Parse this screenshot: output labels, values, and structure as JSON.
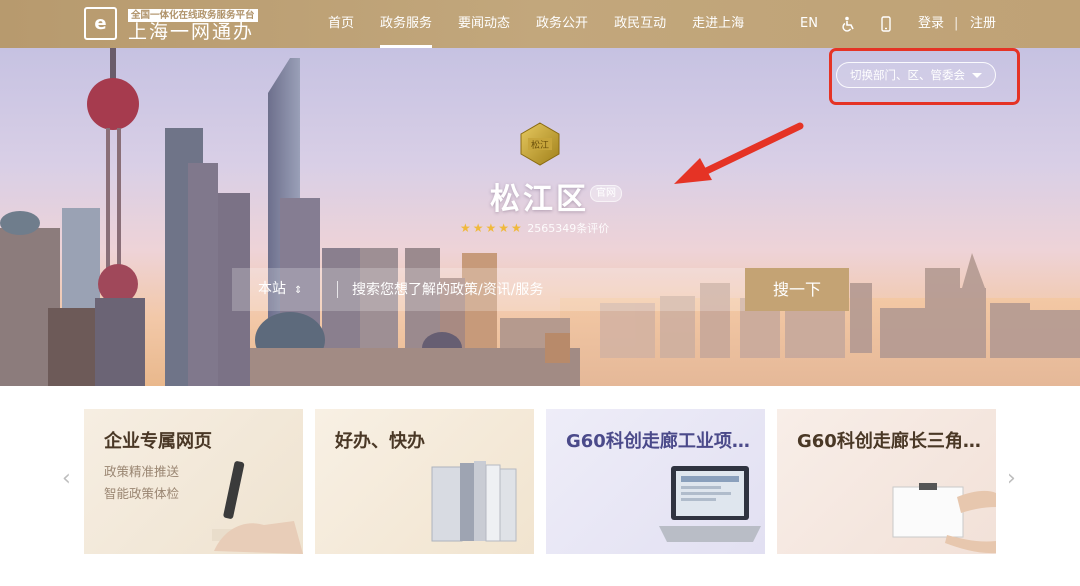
{
  "header": {
    "logo_badge": "全国一体化在线政务服务平台",
    "logo_title": "上海一网通办",
    "nav": [
      {
        "label": "首页"
      },
      {
        "label": "政务服务"
      },
      {
        "label": "要闻动态"
      },
      {
        "label": "政务公开"
      },
      {
        "label": "政民互动"
      },
      {
        "label": "走进上海"
      }
    ],
    "lang": "EN",
    "login": "登录",
    "separator": "|",
    "register": "注册"
  },
  "hero": {
    "switch_label": "切换部门、区、管委会",
    "district_name": "松江区",
    "official_badge": "官网",
    "emblem_text": "松江",
    "stars": "★★★★★",
    "review_count": "2565349条评价",
    "search": {
      "scope": "本站",
      "scope_icon": "⇕",
      "placeholder": "搜索您想了解的政策/资讯/服务",
      "button": "搜一下"
    }
  },
  "cards": [
    {
      "title": "企业专属网页",
      "subs": [
        "政策精准推送",
        "智能政策体检"
      ]
    },
    {
      "title": "好办、快办",
      "subs": []
    },
    {
      "title": "G60科创走廊工业项…",
      "subs": []
    },
    {
      "title": "G60科创走廊长三角…",
      "subs": []
    }
  ],
  "carousel": {
    "prev": "‹",
    "next": "›"
  },
  "colors": {
    "header": "#c0a478",
    "accent": "#c4a374",
    "highlight_box": "#e53325"
  },
  "icons": [
    "logo-icon",
    "accessibility-icon",
    "mobile-icon",
    "caret-down-icon",
    "emblem-icon",
    "chevron-left-icon",
    "chevron-right-icon"
  ]
}
